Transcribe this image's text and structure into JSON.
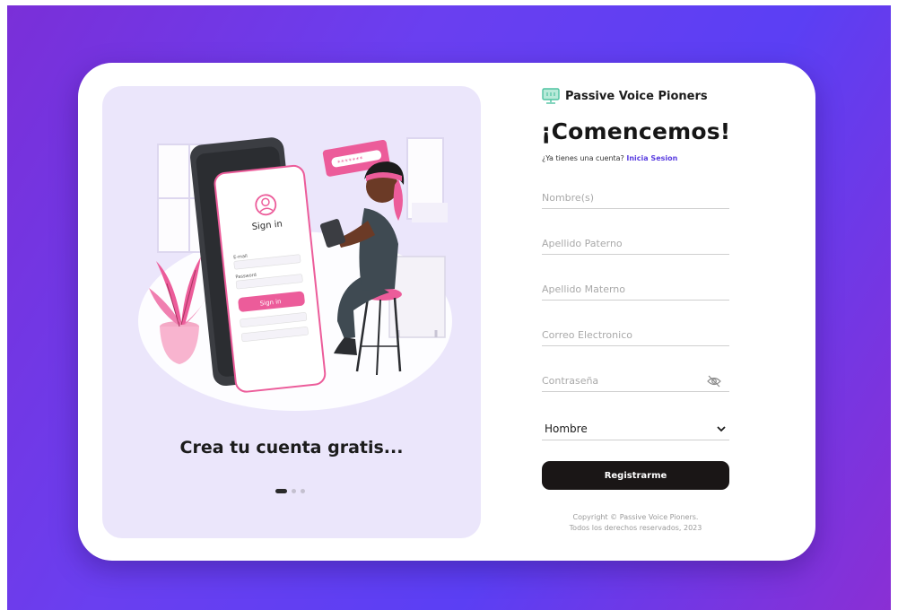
{
  "brand": {
    "name": "Passive Voice Pioners",
    "icon": "monitor-icon",
    "icon_color": "#4fc3a1"
  },
  "left_panel": {
    "tagline": "Crea tu cuenta gratis...",
    "illustration": {
      "phone_title": "Sign in",
      "email_label": "E-mail",
      "password_label": "Password",
      "button_label": "Sign in",
      "bubble_text": "*******"
    },
    "carousel": {
      "total": 3,
      "active_index": 0
    }
  },
  "form": {
    "heading": "¡Comencemos!",
    "have_account_text": "¿Ya tienes una cuenta?",
    "login_link": "Inicia Sesion",
    "fields": {
      "first_name_placeholder": "Nombre(s)",
      "paternal_placeholder": "Apellido Paterno",
      "maternal_placeholder": "Apellido Materno",
      "email_placeholder": "Correo Electronico",
      "password_placeholder": "Contraseña"
    },
    "gender_select": {
      "value": "Hombre"
    },
    "submit_label": "Registrarme",
    "copyright_line1": "Copyright © Passive Voice Pioners.",
    "copyright_line2": "Todos los derechos reservados, 2023"
  },
  "colors": {
    "accent": "#ec5c9a",
    "link": "#5a3ee0",
    "button": "#1a1616",
    "panel": "#ebe6fb",
    "bg_gradient_start": "#7a2fd8",
    "bg_gradient_end": "#5b3ff4"
  }
}
